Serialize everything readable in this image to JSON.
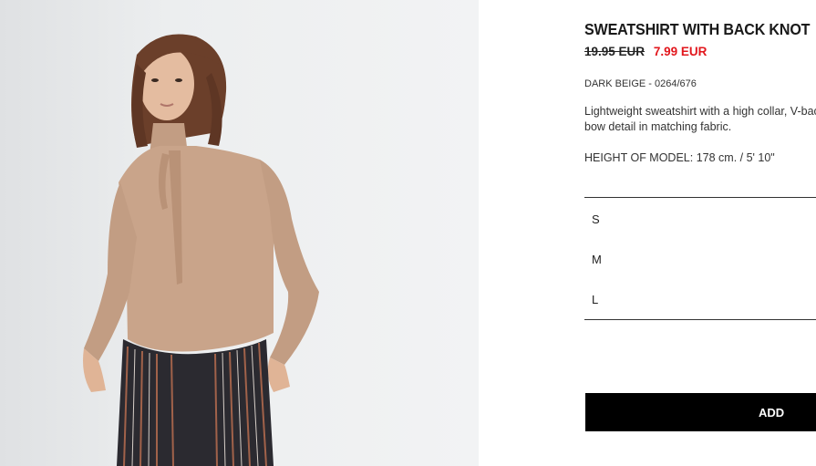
{
  "product": {
    "title": "SWEATSHIRT WITH BACK KNOT",
    "price_old": "19.95 EUR",
    "price_new": "7.99 EUR",
    "color_ref": "DARK BEIGE - 0264/676",
    "description": "Lightweight sweatshirt with a high collar, V-back and bow detail in matching fabric.",
    "model_height": "HEIGHT OF MODEL: 178 cm. / 5' 10\""
  },
  "sizes": [
    "S",
    "M",
    "L"
  ],
  "actions": {
    "add_label": "ADD"
  },
  "colors": {
    "sale_price": "#e2171d",
    "button_bg": "#000000",
    "sweatshirt": "#c9a48a"
  }
}
